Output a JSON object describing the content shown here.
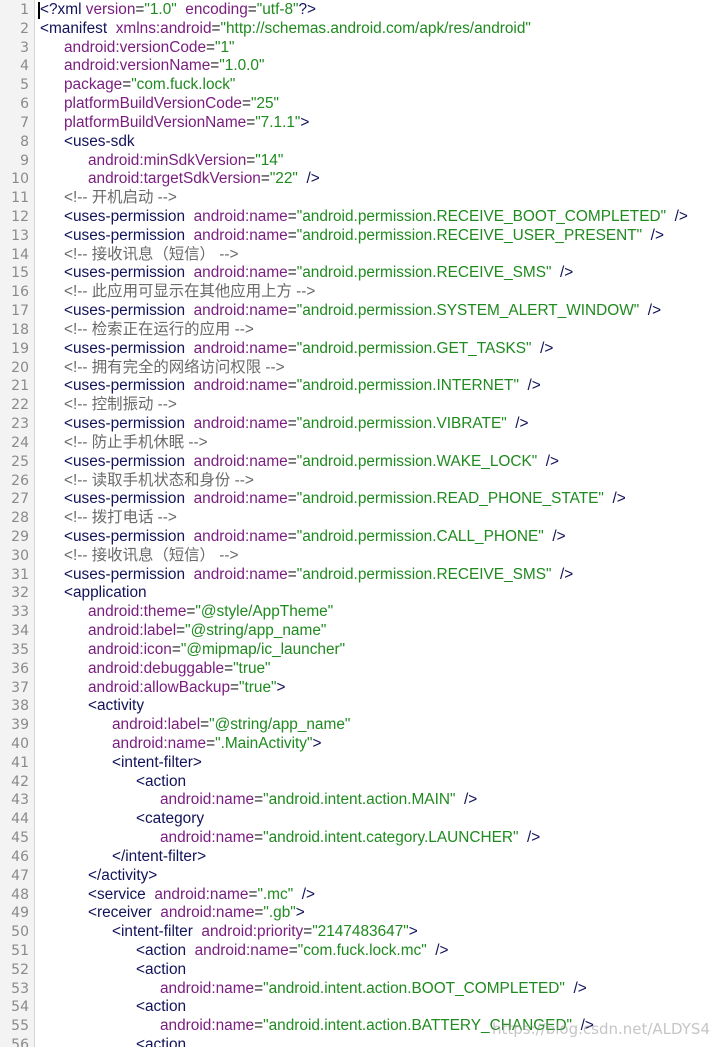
{
  "watermark": "https://blog.csdn.net/ALDYS4",
  "colors": {
    "tag": "#12125a",
    "attribute": "#7a1e80",
    "value": "#1f8a1f",
    "punctuation": "#222222",
    "comment": "#6a6a6a",
    "gutter_background": "#f3f3f3"
  },
  "lines": [
    {
      "n": "1",
      "indent": 0,
      "tokens": [
        [
          "t",
          "<?xml"
        ],
        [
          "p",
          " "
        ],
        [
          "a",
          "version"
        ],
        [
          "p",
          "="
        ],
        [
          "v",
          "\"1.0\""
        ],
        [
          "p",
          "  "
        ],
        [
          "a",
          "encoding"
        ],
        [
          "p",
          "="
        ],
        [
          "v",
          "\"utf-8\""
        ],
        [
          "t",
          "?>"
        ]
      ]
    },
    {
      "n": "2",
      "indent": 0,
      "tokens": [
        [
          "t",
          "<manifest"
        ],
        [
          "p",
          "  "
        ],
        [
          "a",
          "xmlns:android"
        ],
        [
          "p",
          "="
        ],
        [
          "v",
          "\"http://schemas.android.com/apk/res/android\""
        ]
      ]
    },
    {
      "n": "3",
      "indent": 1,
      "tokens": [
        [
          "a",
          "android:versionCode"
        ],
        [
          "p",
          "="
        ],
        [
          "v",
          "\"1\""
        ]
      ]
    },
    {
      "n": "4",
      "indent": 1,
      "tokens": [
        [
          "a",
          "android:versionName"
        ],
        [
          "p",
          "="
        ],
        [
          "v",
          "\"1.0.0\""
        ]
      ]
    },
    {
      "n": "5",
      "indent": 1,
      "tokens": [
        [
          "a",
          "package"
        ],
        [
          "p",
          "="
        ],
        [
          "v",
          "\"com.fuck.lock\""
        ]
      ]
    },
    {
      "n": "6",
      "indent": 1,
      "tokens": [
        [
          "a",
          "platformBuildVersionCode"
        ],
        [
          "p",
          "="
        ],
        [
          "v",
          "\"25\""
        ]
      ]
    },
    {
      "n": "7",
      "indent": 1,
      "tokens": [
        [
          "a",
          "platformBuildVersionName"
        ],
        [
          "p",
          "="
        ],
        [
          "v",
          "\"7.1.1\""
        ],
        [
          "t",
          ">"
        ]
      ]
    },
    {
      "n": "8",
      "indent": 1,
      "tokens": [
        [
          "t",
          "<uses-sdk"
        ]
      ]
    },
    {
      "n": "9",
      "indent": 2,
      "tokens": [
        [
          "a",
          "android:minSdkVersion"
        ],
        [
          "p",
          "="
        ],
        [
          "v",
          "\"14\""
        ]
      ]
    },
    {
      "n": "10",
      "indent": 2,
      "tokens": [
        [
          "a",
          "android:targetSdkVersion"
        ],
        [
          "p",
          "="
        ],
        [
          "v",
          "\"22\""
        ],
        [
          "p",
          "  "
        ],
        [
          "t",
          "/>"
        ]
      ]
    },
    {
      "n": "11",
      "indent": 1,
      "tokens": [
        [
          "c",
          "<!-- 开机启动 -->"
        ]
      ]
    },
    {
      "n": "12",
      "indent": 1,
      "tokens": [
        [
          "t",
          "<uses-permission"
        ],
        [
          "p",
          "  "
        ],
        [
          "a",
          "android:name"
        ],
        [
          "p",
          "="
        ],
        [
          "v",
          "\"android.permission.RECEIVE_BOOT_COMPLETED\""
        ],
        [
          "p",
          "  "
        ],
        [
          "t",
          "/>"
        ]
      ]
    },
    {
      "n": "13",
      "indent": 1,
      "tokens": [
        [
          "t",
          "<uses-permission"
        ],
        [
          "p",
          "  "
        ],
        [
          "a",
          "android:name"
        ],
        [
          "p",
          "="
        ],
        [
          "v",
          "\"android.permission.RECEIVE_USER_PRESENT\""
        ],
        [
          "p",
          "  "
        ],
        [
          "t",
          "/>"
        ]
      ]
    },
    {
      "n": "14",
      "indent": 1,
      "tokens": [
        [
          "c",
          "<!-- 接收讯息（短信） -->"
        ]
      ]
    },
    {
      "n": "15",
      "indent": 1,
      "tokens": [
        [
          "t",
          "<uses-permission"
        ],
        [
          "p",
          "  "
        ],
        [
          "a",
          "android:name"
        ],
        [
          "p",
          "="
        ],
        [
          "v",
          "\"android.permission.RECEIVE_SMS\""
        ],
        [
          "p",
          "  "
        ],
        [
          "t",
          "/>"
        ]
      ]
    },
    {
      "n": "16",
      "indent": 1,
      "tokens": [
        [
          "c",
          "<!-- 此应用可显示在其他应用上方 -->"
        ]
      ]
    },
    {
      "n": "17",
      "indent": 1,
      "tokens": [
        [
          "t",
          "<uses-permission"
        ],
        [
          "p",
          "  "
        ],
        [
          "a",
          "android:name"
        ],
        [
          "p",
          "="
        ],
        [
          "v",
          "\"android.permission.SYSTEM_ALERT_WINDOW\""
        ],
        [
          "p",
          "  "
        ],
        [
          "t",
          "/>"
        ]
      ]
    },
    {
      "n": "18",
      "indent": 1,
      "tokens": [
        [
          "c",
          "<!-- 检索正在运行的应用 -->"
        ]
      ]
    },
    {
      "n": "19",
      "indent": 1,
      "tokens": [
        [
          "t",
          "<uses-permission"
        ],
        [
          "p",
          "  "
        ],
        [
          "a",
          "android:name"
        ],
        [
          "p",
          "="
        ],
        [
          "v",
          "\"android.permission.GET_TASKS\""
        ],
        [
          "p",
          "  "
        ],
        [
          "t",
          "/>"
        ]
      ]
    },
    {
      "n": "20",
      "indent": 1,
      "tokens": [
        [
          "c",
          "<!-- 拥有完全的网络访问权限 -->"
        ]
      ]
    },
    {
      "n": "21",
      "indent": 1,
      "tokens": [
        [
          "t",
          "<uses-permission"
        ],
        [
          "p",
          "  "
        ],
        [
          "a",
          "android:name"
        ],
        [
          "p",
          "="
        ],
        [
          "v",
          "\"android.permission.INTERNET\""
        ],
        [
          "p",
          "  "
        ],
        [
          "t",
          "/>"
        ]
      ]
    },
    {
      "n": "22",
      "indent": 1,
      "tokens": [
        [
          "c",
          "<!-- 控制振动 -->"
        ]
      ]
    },
    {
      "n": "23",
      "indent": 1,
      "tokens": [
        [
          "t",
          "<uses-permission"
        ],
        [
          "p",
          "  "
        ],
        [
          "a",
          "android:name"
        ],
        [
          "p",
          "="
        ],
        [
          "v",
          "\"android.permission.VIBRATE\""
        ],
        [
          "p",
          "  "
        ],
        [
          "t",
          "/>"
        ]
      ]
    },
    {
      "n": "24",
      "indent": 1,
      "tokens": [
        [
          "c",
          "<!-- 防止手机休眠 -->"
        ]
      ]
    },
    {
      "n": "25",
      "indent": 1,
      "tokens": [
        [
          "t",
          "<uses-permission"
        ],
        [
          "p",
          "  "
        ],
        [
          "a",
          "android:name"
        ],
        [
          "p",
          "="
        ],
        [
          "v",
          "\"android.permission.WAKE_LOCK\""
        ],
        [
          "p",
          "  "
        ],
        [
          "t",
          "/>"
        ]
      ]
    },
    {
      "n": "26",
      "indent": 1,
      "tokens": [
        [
          "c",
          "<!-- 读取手机状态和身份 -->"
        ]
      ]
    },
    {
      "n": "27",
      "indent": 1,
      "tokens": [
        [
          "t",
          "<uses-permission"
        ],
        [
          "p",
          "  "
        ],
        [
          "a",
          "android:name"
        ],
        [
          "p",
          "="
        ],
        [
          "v",
          "\"android.permission.READ_PHONE_STATE\""
        ],
        [
          "p",
          "  "
        ],
        [
          "t",
          "/>"
        ]
      ]
    },
    {
      "n": "28",
      "indent": 1,
      "tokens": [
        [
          "c",
          "<!-- 拨打电话 -->"
        ]
      ]
    },
    {
      "n": "29",
      "indent": 1,
      "tokens": [
        [
          "t",
          "<uses-permission"
        ],
        [
          "p",
          "  "
        ],
        [
          "a",
          "android:name"
        ],
        [
          "p",
          "="
        ],
        [
          "v",
          "\"android.permission.CALL_PHONE\""
        ],
        [
          "p",
          "  "
        ],
        [
          "t",
          "/>"
        ]
      ]
    },
    {
      "n": "30",
      "indent": 1,
      "tokens": [
        [
          "c",
          "<!-- 接收讯息（短信） -->"
        ]
      ]
    },
    {
      "n": "31",
      "indent": 1,
      "tokens": [
        [
          "t",
          "<uses-permission"
        ],
        [
          "p",
          "  "
        ],
        [
          "a",
          "android:name"
        ],
        [
          "p",
          "="
        ],
        [
          "v",
          "\"android.permission.RECEIVE_SMS\""
        ],
        [
          "p",
          "  "
        ],
        [
          "t",
          "/>"
        ]
      ]
    },
    {
      "n": "32",
      "indent": 1,
      "tokens": [
        [
          "t",
          "<application"
        ]
      ]
    },
    {
      "n": "33",
      "indent": 2,
      "tokens": [
        [
          "a",
          "android:theme"
        ],
        [
          "p",
          "="
        ],
        [
          "v",
          "\"@style/AppTheme\""
        ]
      ]
    },
    {
      "n": "34",
      "indent": 2,
      "tokens": [
        [
          "a",
          "android:label"
        ],
        [
          "p",
          "="
        ],
        [
          "v",
          "\"@string/app_name\""
        ]
      ]
    },
    {
      "n": "35",
      "indent": 2,
      "tokens": [
        [
          "a",
          "android:icon"
        ],
        [
          "p",
          "="
        ],
        [
          "v",
          "\"@mipmap/ic_launcher\""
        ]
      ]
    },
    {
      "n": "36",
      "indent": 2,
      "tokens": [
        [
          "a",
          "android:debuggable"
        ],
        [
          "p",
          "="
        ],
        [
          "v",
          "\"true\""
        ]
      ]
    },
    {
      "n": "37",
      "indent": 2,
      "tokens": [
        [
          "a",
          "android:allowBackup"
        ],
        [
          "p",
          "="
        ],
        [
          "v",
          "\"true\""
        ],
        [
          "t",
          ">"
        ]
      ]
    },
    {
      "n": "38",
      "indent": 2,
      "tokens": [
        [
          "t",
          "<activity"
        ]
      ]
    },
    {
      "n": "39",
      "indent": 3,
      "tokens": [
        [
          "a",
          "android:label"
        ],
        [
          "p",
          "="
        ],
        [
          "v",
          "\"@string/app_name\""
        ]
      ]
    },
    {
      "n": "40",
      "indent": 3,
      "tokens": [
        [
          "a",
          "android:name"
        ],
        [
          "p",
          "="
        ],
        [
          "v",
          "\".MainActivity\""
        ],
        [
          "t",
          ">"
        ]
      ]
    },
    {
      "n": "41",
      "indent": 3,
      "tokens": [
        [
          "t",
          "<intent-filter>"
        ]
      ]
    },
    {
      "n": "42",
      "indent": 4,
      "tokens": [
        [
          "t",
          "<action"
        ]
      ]
    },
    {
      "n": "43",
      "indent": 5,
      "tokens": [
        [
          "a",
          "android:name"
        ],
        [
          "p",
          "="
        ],
        [
          "v",
          "\"android.intent.action.MAIN\""
        ],
        [
          "p",
          "  "
        ],
        [
          "t",
          "/>"
        ]
      ]
    },
    {
      "n": "44",
      "indent": 4,
      "tokens": [
        [
          "t",
          "<category"
        ]
      ]
    },
    {
      "n": "45",
      "indent": 5,
      "tokens": [
        [
          "a",
          "android:name"
        ],
        [
          "p",
          "="
        ],
        [
          "v",
          "\"android.intent.category.LAUNCHER\""
        ],
        [
          "p",
          "  "
        ],
        [
          "t",
          "/>"
        ]
      ]
    },
    {
      "n": "46",
      "indent": 3,
      "tokens": [
        [
          "t",
          "</intent-filter>"
        ]
      ]
    },
    {
      "n": "47",
      "indent": 2,
      "tokens": [
        [
          "t",
          "</activity>"
        ]
      ]
    },
    {
      "n": "48",
      "indent": 2,
      "tokens": [
        [
          "t",
          "<service"
        ],
        [
          "p",
          "  "
        ],
        [
          "a",
          "android:name"
        ],
        [
          "p",
          "="
        ],
        [
          "v",
          "\".mc\""
        ],
        [
          "p",
          "  "
        ],
        [
          "t",
          "/>"
        ]
      ]
    },
    {
      "n": "49",
      "indent": 2,
      "tokens": [
        [
          "t",
          "<receiver"
        ],
        [
          "p",
          "  "
        ],
        [
          "a",
          "android:name"
        ],
        [
          "p",
          "="
        ],
        [
          "v",
          "\".gb\""
        ],
        [
          "t",
          ">"
        ]
      ]
    },
    {
      "n": "50",
      "indent": 3,
      "tokens": [
        [
          "t",
          "<intent-filter"
        ],
        [
          "p",
          "  "
        ],
        [
          "a",
          "android:priority"
        ],
        [
          "p",
          "="
        ],
        [
          "v",
          "\"2147483647\""
        ],
        [
          "t",
          ">"
        ]
      ]
    },
    {
      "n": "51",
      "indent": 4,
      "tokens": [
        [
          "t",
          "<action"
        ],
        [
          "p",
          "  "
        ],
        [
          "a",
          "android:name"
        ],
        [
          "p",
          "="
        ],
        [
          "v",
          "\"com.fuck.lock.mc\""
        ],
        [
          "p",
          "  "
        ],
        [
          "t",
          "/>"
        ]
      ]
    },
    {
      "n": "52",
      "indent": 4,
      "tokens": [
        [
          "t",
          "<action"
        ]
      ]
    },
    {
      "n": "53",
      "indent": 5,
      "tokens": [
        [
          "a",
          "android:name"
        ],
        [
          "p",
          "="
        ],
        [
          "v",
          "\"android.intent.action.BOOT_COMPLETED\""
        ],
        [
          "p",
          "  "
        ],
        [
          "t",
          "/>"
        ]
      ]
    },
    {
      "n": "54",
      "indent": 4,
      "tokens": [
        [
          "t",
          "<action"
        ]
      ]
    },
    {
      "n": "55",
      "indent": 5,
      "tokens": [
        [
          "a",
          "android:name"
        ],
        [
          "p",
          "="
        ],
        [
          "v",
          "\"android.intent.action.BATTERY_CHANGED\""
        ],
        [
          "p",
          "  "
        ],
        [
          "t",
          "/>"
        ]
      ]
    },
    {
      "n": "56",
      "indent": 4,
      "tokens": [
        [
          "t",
          "<action"
        ]
      ]
    }
  ]
}
